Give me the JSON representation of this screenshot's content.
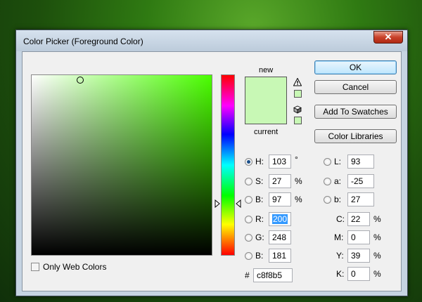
{
  "window": {
    "title": "Color Picker (Foreground Color)",
    "close_label": "✕"
  },
  "colors": {
    "current_hex": "#c8f8b5",
    "hue_top": "#ff0000"
  },
  "preview": {
    "new_label": "new",
    "current_label": "current"
  },
  "icons": {
    "gamut_warning": "warning-icon",
    "web_safe": "cube-icon"
  },
  "buttons": {
    "ok": "OK",
    "cancel": "Cancel",
    "add_to_swatches": "Add To Swatches",
    "color_libraries": "Color Libraries"
  },
  "hsb": {
    "h": {
      "label": "H:",
      "value": "103",
      "unit": "°",
      "selected": true
    },
    "s": {
      "label": "S:",
      "value": "27",
      "unit": "%"
    },
    "b": {
      "label": "B:",
      "value": "97",
      "unit": "%"
    }
  },
  "rgb": {
    "r": {
      "label": "R:",
      "value": "200"
    },
    "g": {
      "label": "G:",
      "value": "248"
    },
    "b": {
      "label": "B:",
      "value": "181"
    }
  },
  "lab": {
    "l": {
      "label": "L:",
      "value": "93"
    },
    "a": {
      "label": "a:",
      "value": "-25"
    },
    "b": {
      "label": "b:",
      "value": "27"
    }
  },
  "cmyk": {
    "c": {
      "label": "C:",
      "value": "22",
      "unit": "%"
    },
    "m": {
      "label": "M:",
      "value": "0",
      "unit": "%"
    },
    "y": {
      "label": "Y:",
      "value": "39",
      "unit": "%"
    },
    "k": {
      "label": "K:",
      "value": "0",
      "unit": "%"
    }
  },
  "hex": {
    "label": "#",
    "value": "c8f8b5"
  },
  "options": {
    "only_web_colors": "Only Web Colors"
  }
}
